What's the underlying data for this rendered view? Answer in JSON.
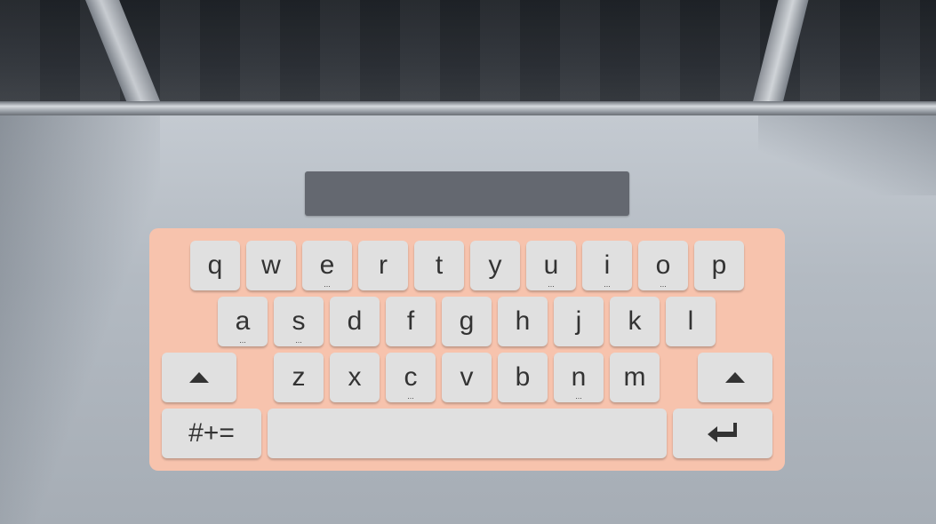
{
  "keyboard": {
    "display_text": "",
    "row1": [
      {
        "label": "q",
        "dots": ""
      },
      {
        "label": "w",
        "dots": ""
      },
      {
        "label": "e",
        "dots": "..."
      },
      {
        "label": "r",
        "dots": ""
      },
      {
        "label": "t",
        "dots": ""
      },
      {
        "label": "y",
        "dots": ""
      },
      {
        "label": "u",
        "dots": "..."
      },
      {
        "label": "i",
        "dots": "..."
      },
      {
        "label": "o",
        "dots": "..."
      },
      {
        "label": "p",
        "dots": ""
      }
    ],
    "row2": [
      {
        "label": "a",
        "dots": "..."
      },
      {
        "label": "s",
        "dots": "..."
      },
      {
        "label": "d",
        "dots": ""
      },
      {
        "label": "f",
        "dots": ""
      },
      {
        "label": "g",
        "dots": ""
      },
      {
        "label": "h",
        "dots": ""
      },
      {
        "label": "j",
        "dots": ""
      },
      {
        "label": "k",
        "dots": ""
      },
      {
        "label": "l",
        "dots": ""
      }
    ],
    "row3": [
      {
        "label": "z",
        "dots": ""
      },
      {
        "label": "x",
        "dots": ""
      },
      {
        "label": "c",
        "dots": "..."
      },
      {
        "label": "v",
        "dots": ""
      },
      {
        "label": "b",
        "dots": ""
      },
      {
        "label": "n",
        "dots": "..."
      },
      {
        "label": "m",
        "dots": ""
      }
    ],
    "symbols_label": "#+=",
    "shift_icon": "shift-up-arrow-icon",
    "enter_icon": "enter-return-icon",
    "colors": {
      "panel": "#f7c3ad",
      "key": "#e0e0e0",
      "key_text": "#333333",
      "display": "#646870"
    }
  }
}
